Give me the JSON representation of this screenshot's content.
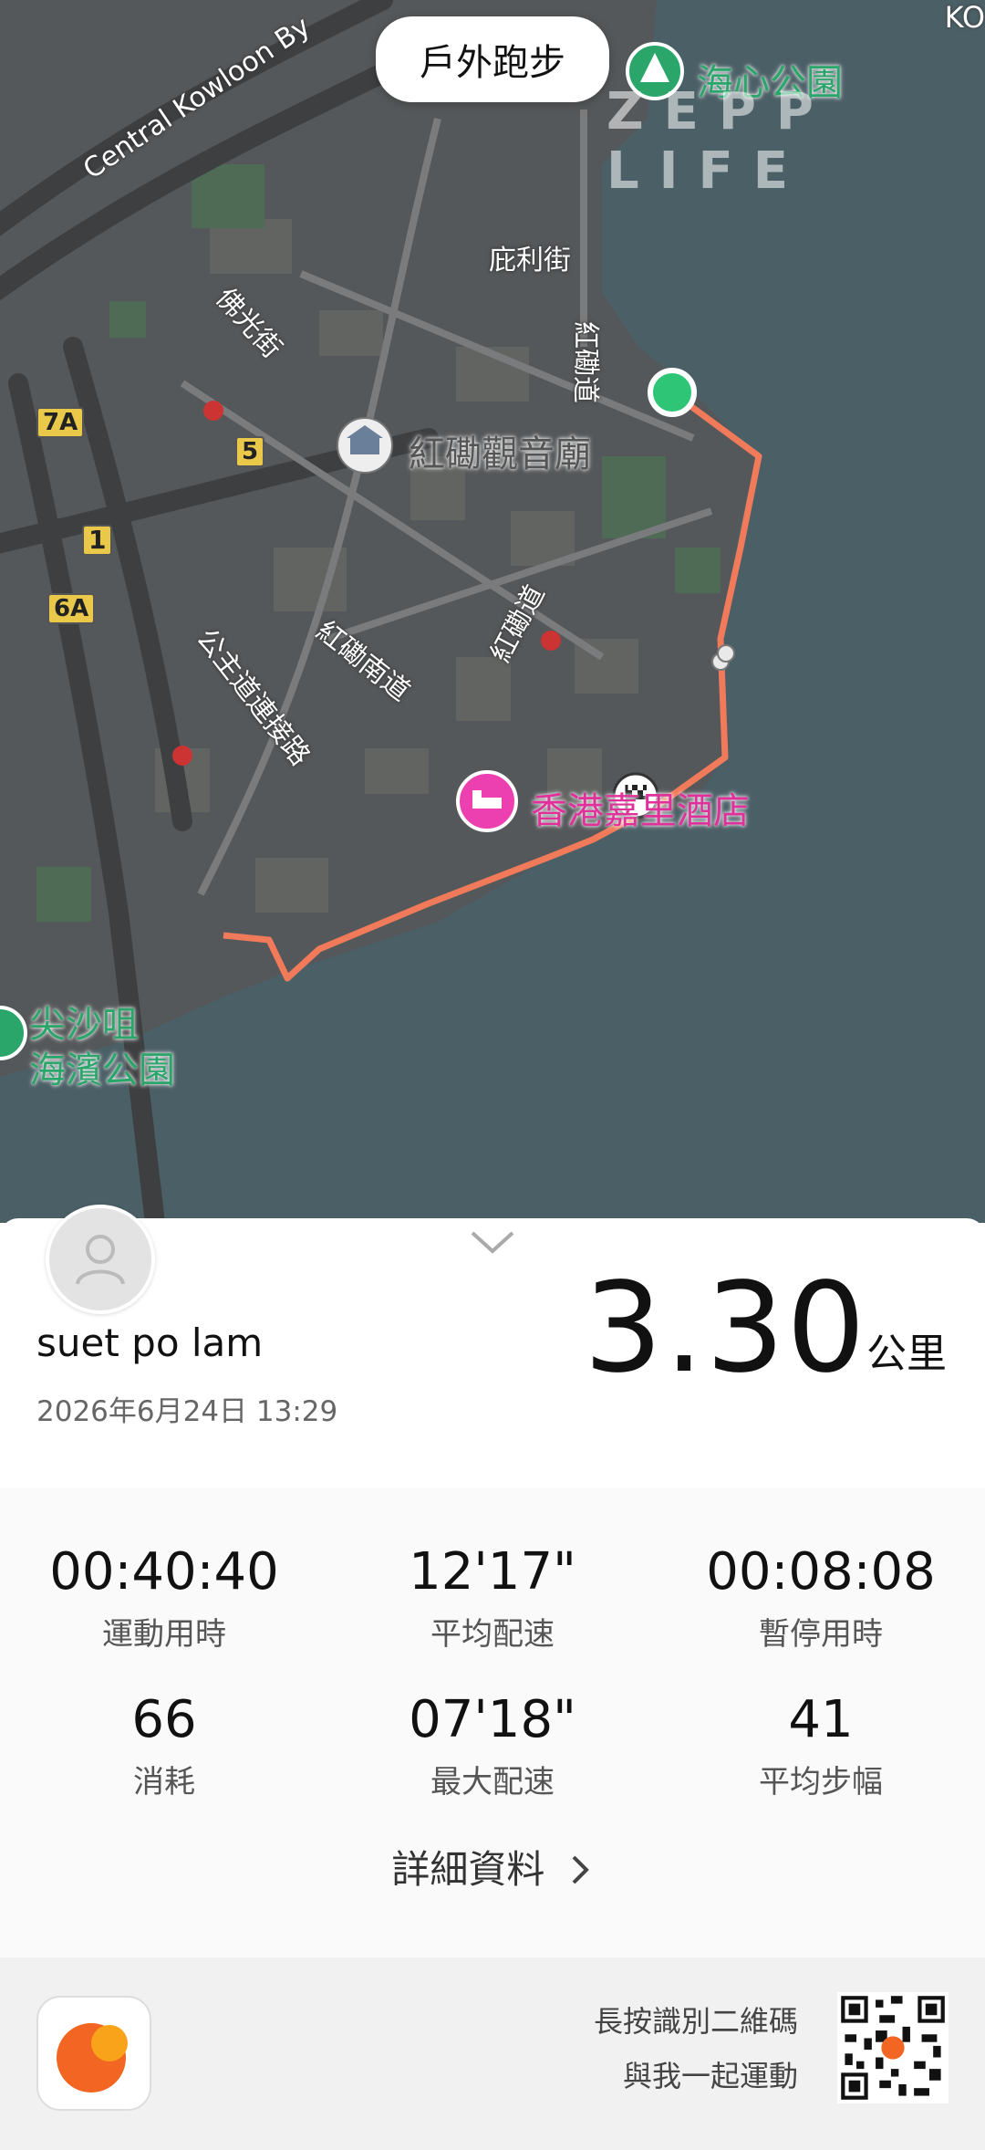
{
  "header": {
    "mode_label": "戶外跑步",
    "brand": "ZEPP LIFE",
    "corner_text": "KO"
  },
  "map": {
    "road_labels": [
      "Central Kowloon By",
      "佛光街",
      "庇利街",
      "紅磡道",
      "紅磡南道",
      "紅磡道",
      "公主道連接路"
    ],
    "poi_labels": {
      "park_top": "海心公園",
      "temple": "紅磡觀音廟",
      "hotel": "香港嘉里酒店",
      "park_bottom_line1": "尖沙咀",
      "park_bottom_line2": "海濱公園"
    },
    "route_shields": [
      "7A",
      "5",
      "1",
      "6A"
    ],
    "colors": {
      "route": "#f07a5a",
      "start": "#2fc576",
      "water": "#4b5f66"
    }
  },
  "summary": {
    "username": "suet po lam",
    "datetime": "2026年6月24日 13:29",
    "distance": "3.30",
    "distance_unit": "公里"
  },
  "stats": [
    {
      "value": "00:40:40",
      "label": "運動用時"
    },
    {
      "value": "12'17\"",
      "label": "平均配速"
    },
    {
      "value": "00:08:08",
      "label": "暫停用時"
    },
    {
      "value": "66",
      "label": "消耗"
    },
    {
      "value": "07'18\"",
      "label": "最大配速"
    },
    {
      "value": "41",
      "label": "平均步幅"
    }
  ],
  "detail_link": "詳細資料",
  "footer": {
    "line1": "長按識別二維碼",
    "line2": "與我一起運動"
  }
}
